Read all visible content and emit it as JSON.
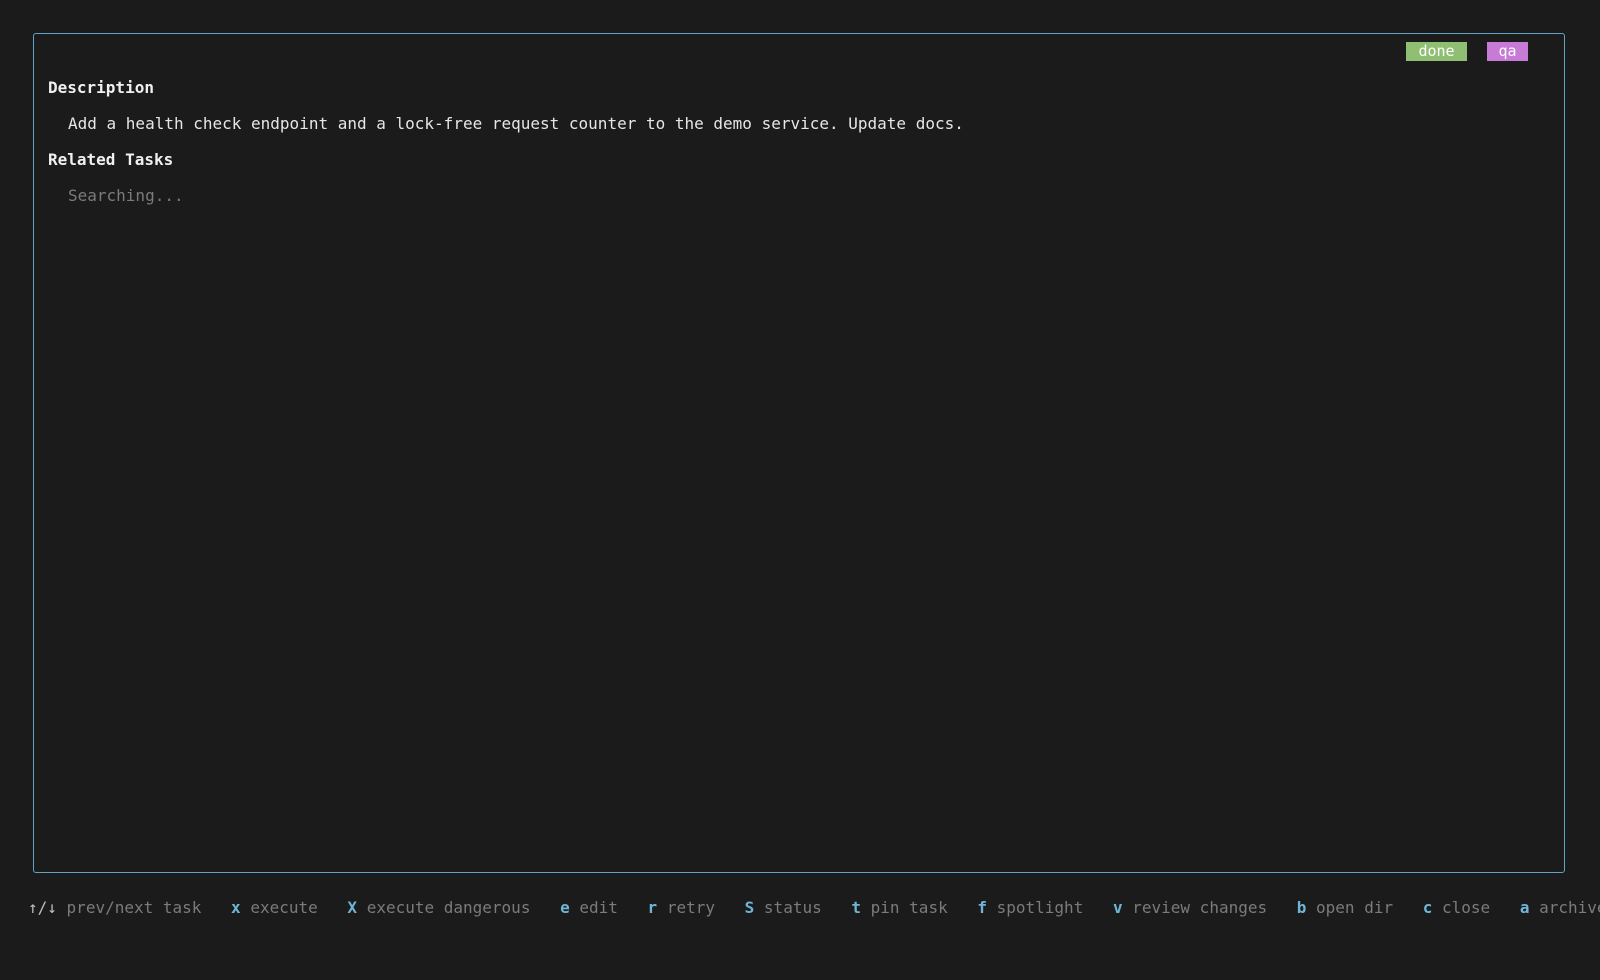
{
  "task": {
    "badges": {
      "status": "done",
      "tag": "qa"
    },
    "description_heading": "Description",
    "description_text": "Add a health check endpoint and a lock-free request counter to the demo service. Update docs.",
    "related_heading": "Related Tasks",
    "related_status": "Searching..."
  },
  "footer": {
    "hints": [
      {
        "key": "↑/↓",
        "label": "prev/next task"
      },
      {
        "key": "x",
        "label": "execute"
      },
      {
        "key": "X",
        "label": "execute dangerous"
      },
      {
        "key": "e",
        "label": "edit"
      },
      {
        "key": "r",
        "label": "retry"
      },
      {
        "key": "S",
        "label": "status"
      },
      {
        "key": "t",
        "label": "pin task"
      },
      {
        "key": "f",
        "label": "spotlight"
      },
      {
        "key": "v",
        "label": "review changes"
      },
      {
        "key": "b",
        "label": "open dir"
      },
      {
        "key": "c",
        "label": "close"
      },
      {
        "key": "a",
        "label": "archive"
      }
    ]
  },
  "colors": {
    "border_accent": "#5fa3c7",
    "status_done": "#8fbf72",
    "tag_qa": "#c77ad6",
    "key_accent": "#6fb5d6"
  }
}
